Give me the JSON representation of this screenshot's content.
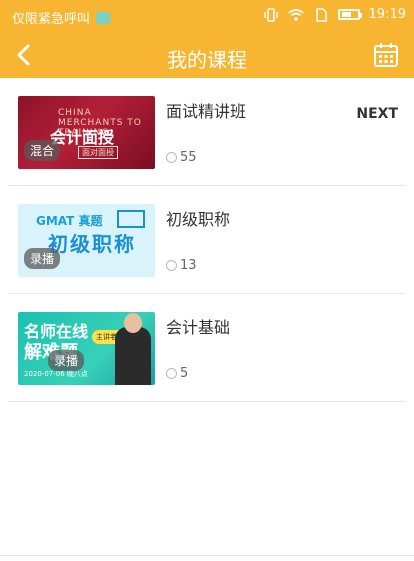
{
  "status_bar": {
    "carrier": "仅限紧急呼叫",
    "time": "19:19",
    "icons": [
      "vibrate-icon",
      "wifi-icon",
      "sim-icon",
      "battery-icon"
    ]
  },
  "navbar": {
    "title": "我的课程",
    "back_icon": "chevron-left-icon",
    "calendar_icon": "calendar-icon"
  },
  "courses": [
    {
      "title": "面试精讲班",
      "count": "55",
      "tag": "混合",
      "thumb_text": "会计面授",
      "thumb_subtext": "面对面授",
      "thumb_banner": "CHINA MERCHANTS TO TRAINING",
      "action": "NEXT"
    },
    {
      "title": "初级职称",
      "count": "13",
      "tag": "录播",
      "thumb_text": "初级职称",
      "thumb_subtext": "GMAT 真题"
    },
    {
      "title": "会计基础",
      "count": "5",
      "tag": "录播",
      "thumb_text_line1": "名师在线",
      "thumb_text_line2": "解难题",
      "thumb_bubble": "主讲老师 MIKE",
      "thumb_date": "2020-07-06 晚八点"
    }
  ],
  "colors": {
    "accent": "#f7b531"
  }
}
